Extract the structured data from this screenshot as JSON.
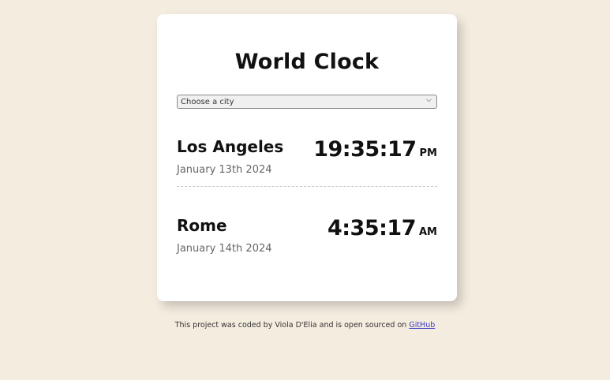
{
  "app": {
    "title": "World Clock"
  },
  "city_select": {
    "selected": "Choose a city",
    "options": [
      "Choose a city"
    ],
    "chevron_icon": "chevron-down-icon"
  },
  "cities": [
    {
      "name": "Los Angeles",
      "date": "January 13th 2024",
      "time": "19:35:17",
      "ampm": "PM"
    },
    {
      "name": "Rome",
      "date": "January 14th 2024",
      "time": "4:35:17",
      "ampm": "AM"
    }
  ],
  "footer": {
    "text": "This project was coded by Viola D'Elia and is open sourced on",
    "link_label": "GitHub"
  },
  "colors": {
    "background": "#f4ecdf",
    "card": "#ffffff",
    "link": "#3a3ac8"
  }
}
